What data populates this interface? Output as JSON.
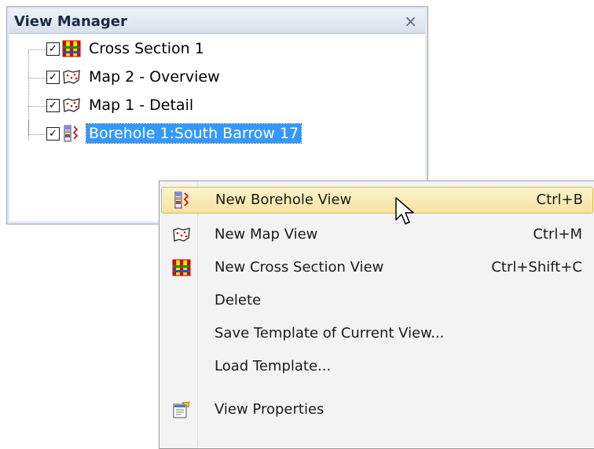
{
  "panel": {
    "title": "View Manager",
    "close_glyph": "×",
    "items": [
      {
        "label": "Cross Section 1",
        "checked": true,
        "icon": "cross-section-icon",
        "selected": false
      },
      {
        "label": "Map 2 - Overview",
        "checked": true,
        "icon": "map-icon",
        "selected": false
      },
      {
        "label": "Map 1 - Detail",
        "checked": true,
        "icon": "map-icon",
        "selected": false
      },
      {
        "label": "Borehole 1:South Barrow 17",
        "checked": true,
        "icon": "borehole-icon",
        "selected": true
      }
    ]
  },
  "context_menu": {
    "items": [
      {
        "label": "New Borehole View",
        "shortcut": "Ctrl+B",
        "icon": "borehole-icon",
        "highlighted": true
      },
      {
        "label": "New Map View",
        "shortcut": "Ctrl+M",
        "icon": "map-icon",
        "highlighted": false
      },
      {
        "label": "New Cross Section View",
        "shortcut": "Ctrl+Shift+C",
        "icon": "cross-section-icon",
        "highlighted": false
      },
      {
        "label": "Delete",
        "shortcut": "",
        "icon": "",
        "highlighted": false
      },
      {
        "label": "Save Template of Current View...",
        "shortcut": "",
        "icon": "",
        "highlighted": false
      },
      {
        "label": "Load Template...",
        "shortcut": "",
        "icon": "",
        "highlighted": false
      },
      {
        "label": "View Properties",
        "shortcut": "",
        "icon": "properties-icon",
        "highlighted": false
      }
    ]
  },
  "colors": {
    "selection": "#3399ff",
    "menu_hover": "#f6e3a0",
    "panel_title_text": "#1b2a45"
  }
}
